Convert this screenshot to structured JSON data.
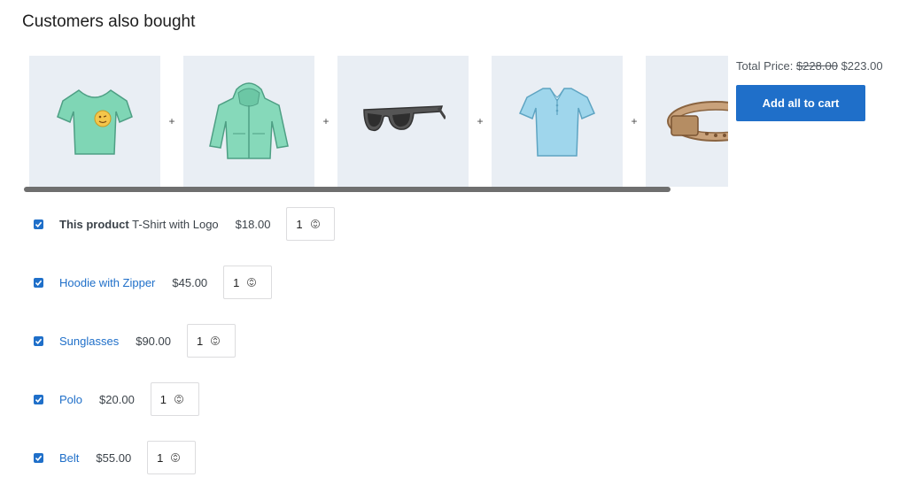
{
  "section": {
    "title": "Customers also bought"
  },
  "carousel": {
    "separator": "+",
    "items": [
      {
        "icon": "tshirt-with-logo-image"
      },
      {
        "icon": "hoodie-with-zipper-image"
      },
      {
        "icon": "sunglasses-image"
      },
      {
        "icon": "polo-image"
      },
      {
        "icon": "belt-image"
      }
    ]
  },
  "total": {
    "label": "Total Price:",
    "old_price": "$228.00",
    "new_price": "$223.00"
  },
  "add_all_button": {
    "label": "Add all to cart"
  },
  "products": [
    {
      "prefix": "This product",
      "name": "T-Shirt with Logo",
      "price": "$18.00",
      "qty": "1",
      "checked": true,
      "is_link": false
    },
    {
      "name": "Hoodie with Zipper",
      "price": "$45.00",
      "qty": "1",
      "checked": true,
      "is_link": true
    },
    {
      "name": "Sunglasses",
      "price": "$90.00",
      "qty": "1",
      "checked": true,
      "is_link": true
    },
    {
      "name": "Polo",
      "price": "$20.00",
      "qty": "1",
      "checked": true,
      "is_link": true
    },
    {
      "name": "Belt",
      "price": "$55.00",
      "qty": "1",
      "checked": true,
      "is_link": true
    }
  ],
  "colors": {
    "accent": "#1f6fc9",
    "thumb_bg": "#e9eef4"
  }
}
